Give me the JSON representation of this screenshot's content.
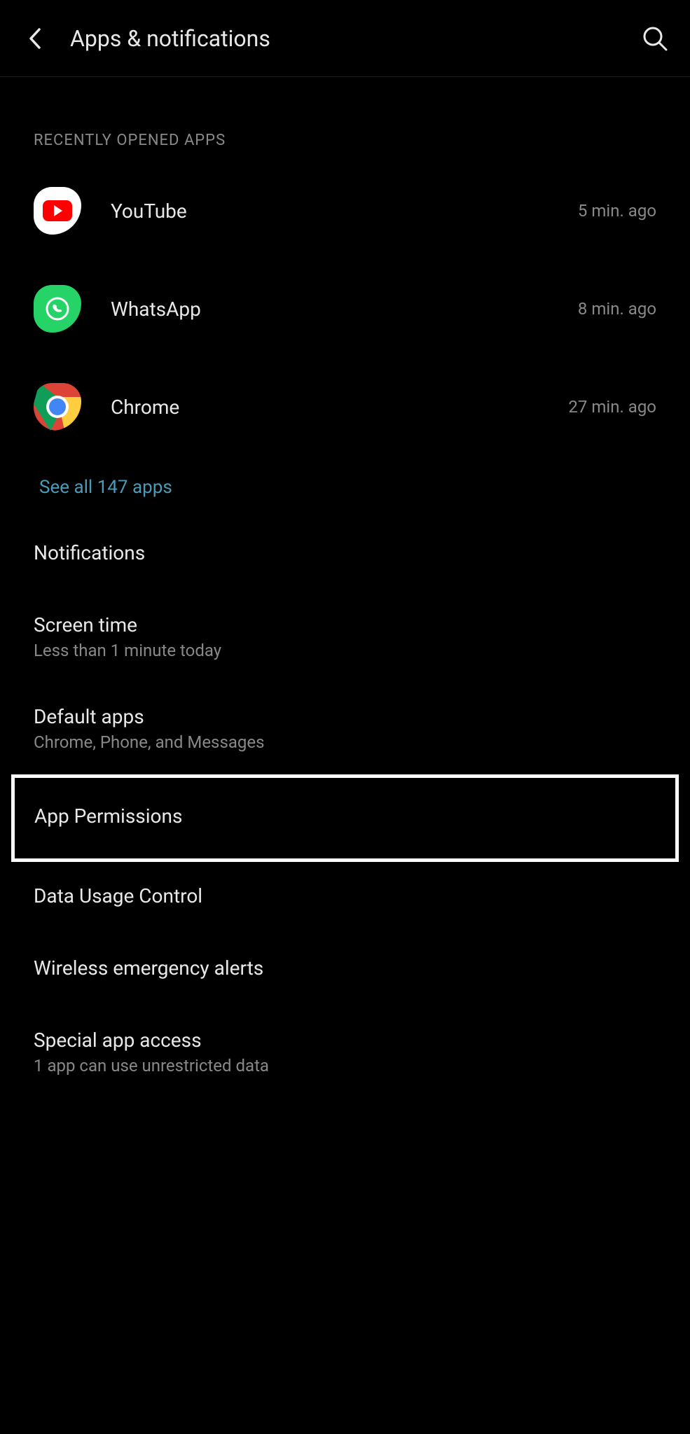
{
  "header": {
    "title": "Apps & notifications"
  },
  "section_header": "RECENTLY OPENED APPS",
  "apps": [
    {
      "name": "YouTube",
      "time": "5 min. ago"
    },
    {
      "name": "WhatsApp",
      "time": "8 min. ago"
    },
    {
      "name": "Chrome",
      "time": "27 min. ago"
    }
  ],
  "see_all": "See all 147 apps",
  "settings": [
    {
      "title": "Notifications",
      "subtitle": ""
    },
    {
      "title": "Screen time",
      "subtitle": "Less than 1 minute today"
    },
    {
      "title": "Default apps",
      "subtitle": "Chrome, Phone, and Messages"
    },
    {
      "title": "App Permissions",
      "subtitle": "",
      "highlighted": true
    },
    {
      "title": "Data Usage Control",
      "subtitle": ""
    },
    {
      "title": "Wireless emergency alerts",
      "subtitle": ""
    },
    {
      "title": "Special app access",
      "subtitle": "1 app can use unrestricted data"
    }
  ]
}
